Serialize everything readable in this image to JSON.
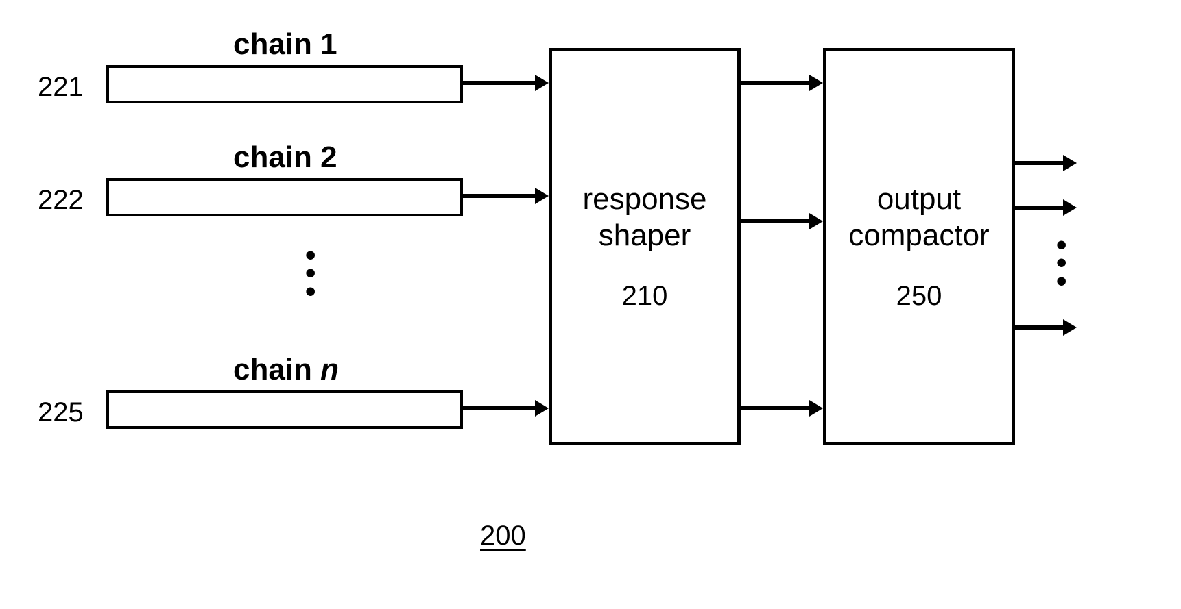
{
  "chains": [
    {
      "label": "chain 1",
      "ref": "221"
    },
    {
      "label": "chain 2",
      "ref": "222"
    },
    {
      "label": "chain n",
      "ref": "225"
    }
  ],
  "response_shaper": {
    "label_line1": "response",
    "label_line2": "shaper",
    "ref": "210"
  },
  "output_compactor": {
    "label_line1": "output",
    "label_line2": "compactor",
    "ref": "250"
  },
  "figure_ref": "200"
}
